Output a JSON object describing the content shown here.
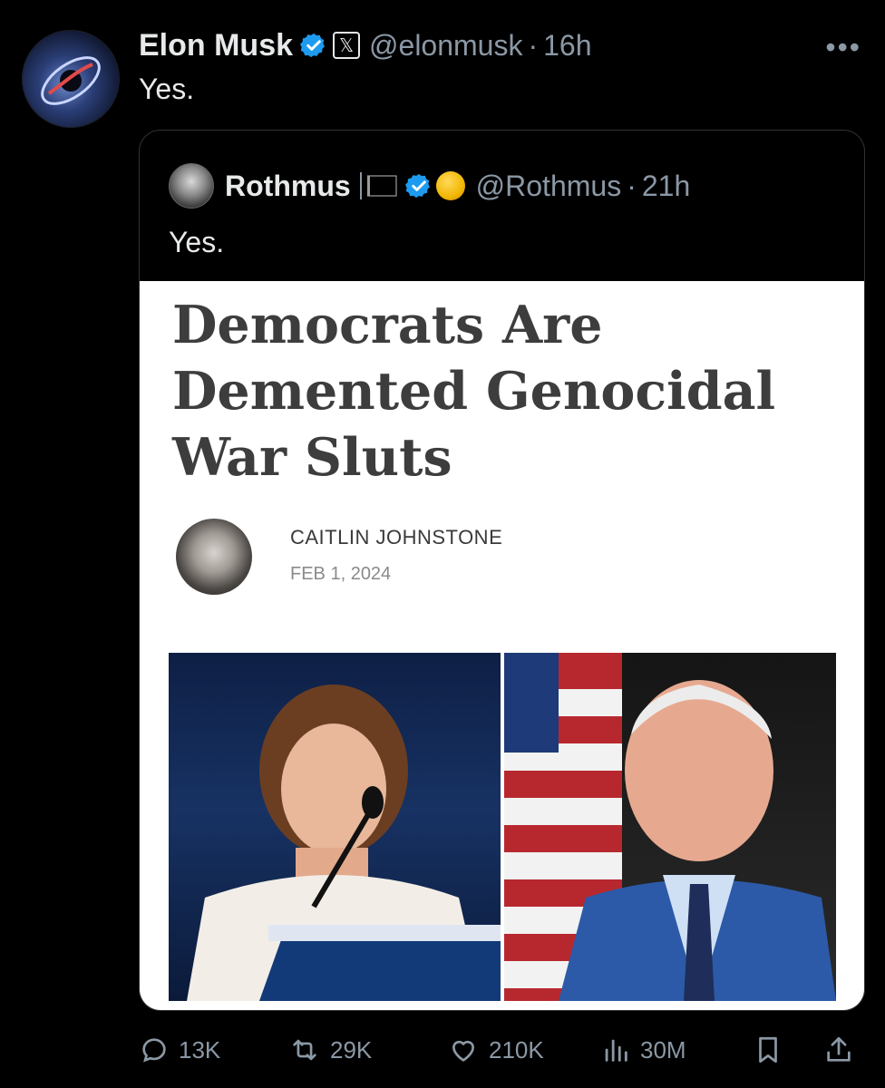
{
  "tweet": {
    "author_name": "Elon Musk",
    "handle": "@elonmusk",
    "separator": "·",
    "time": "16h",
    "text": "Yes.",
    "more_label": "•••"
  },
  "quote": {
    "author_name": "Rothmus",
    "handle": "@Rothmus",
    "separator": "·",
    "time": "21h",
    "text": "Yes."
  },
  "article": {
    "headline": "Democrats Are Demented Genocidal War Sluts",
    "author": "CAITLIN JOHNSTONE",
    "date": "FEB 1, 2024"
  },
  "actions": {
    "replies": "13K",
    "reposts": "29K",
    "likes": "210K",
    "views": "30M"
  },
  "icons": [
    "verified-badge-icon",
    "x-logo-icon",
    "black-flag-icon",
    "yellow-circle-icon",
    "reply-icon",
    "repost-icon",
    "like-icon",
    "views-icon",
    "bookmark-icon",
    "share-icon",
    "more-icon"
  ],
  "colors": {
    "background": "#000000",
    "text": "#e7e9ea",
    "muted": "#8b98a5",
    "verified": "#1d9bf0"
  }
}
